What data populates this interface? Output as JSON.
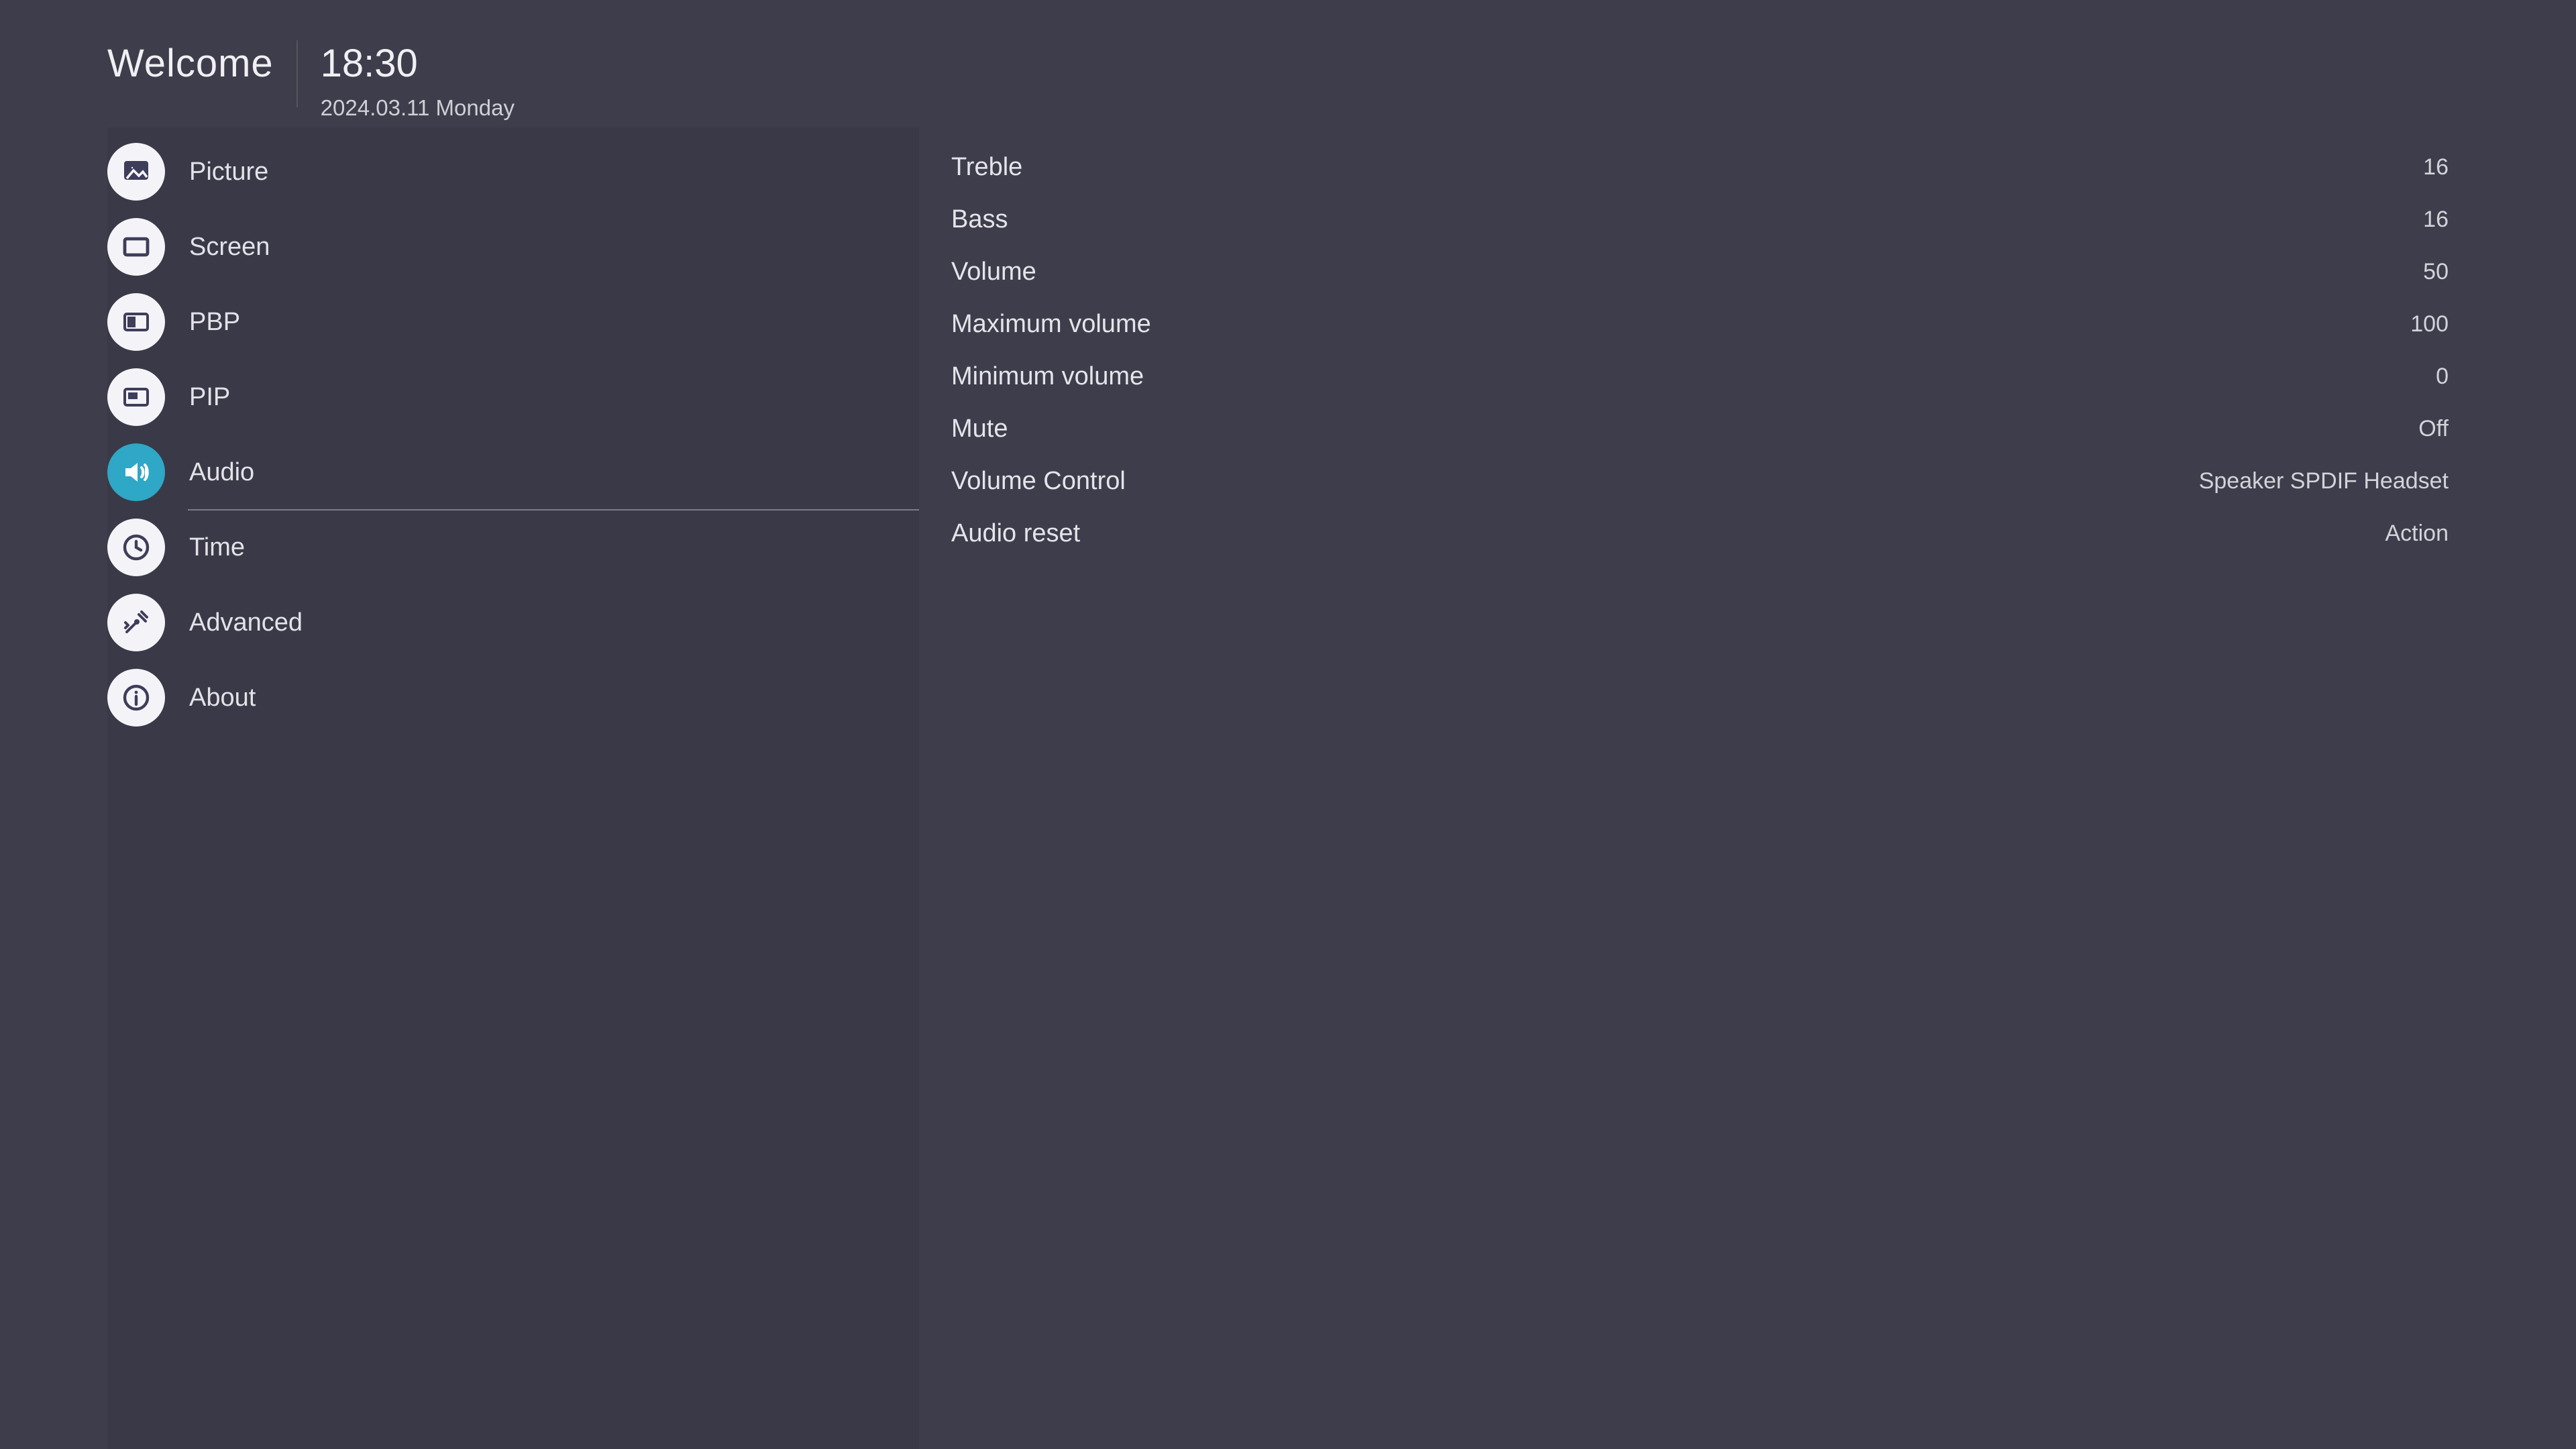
{
  "header": {
    "welcome": "Welcome",
    "time": "18:30",
    "date": "2024.03.11 Monday"
  },
  "sidebar": {
    "items": [
      {
        "label": "Picture",
        "icon": "picture",
        "active": false
      },
      {
        "label": "Screen",
        "icon": "screen",
        "active": false
      },
      {
        "label": "PBP",
        "icon": "pbp",
        "active": false
      },
      {
        "label": "PIP",
        "icon": "pip",
        "active": false
      },
      {
        "label": "Audio",
        "icon": "audio",
        "active": true
      },
      {
        "label": "Time",
        "icon": "time",
        "active": false
      },
      {
        "label": "Advanced",
        "icon": "advanced",
        "active": false
      },
      {
        "label": "About",
        "icon": "about",
        "active": false
      }
    ]
  },
  "content": {
    "rows": [
      {
        "label": "Treble",
        "value": "16"
      },
      {
        "label": "Bass",
        "value": "16"
      },
      {
        "label": "Volume",
        "value": "50"
      },
      {
        "label": "Maximum volume",
        "value": "100"
      },
      {
        "label": "Minimum volume",
        "value": "0"
      },
      {
        "label": "Mute",
        "value": "Off"
      },
      {
        "label": "Volume Control",
        "value": "Speaker SPDIF Headset"
      },
      {
        "label": "Audio reset",
        "value": "Action"
      }
    ]
  },
  "colors": {
    "bg": "#3e3d4b",
    "sidebar_bg": "#3a3947",
    "accent": "#2fa7c6",
    "icon_dark": "#3e3d5a"
  }
}
